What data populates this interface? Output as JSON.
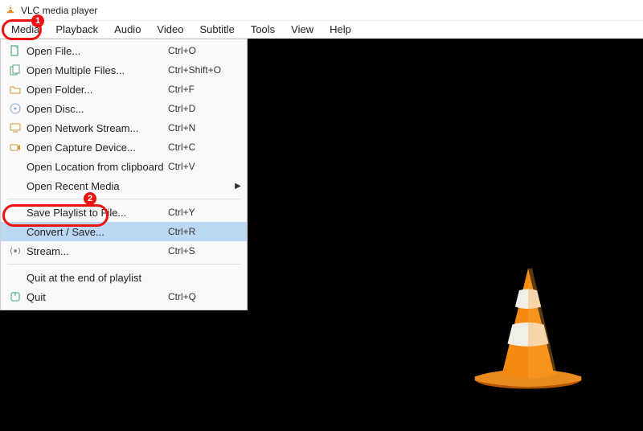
{
  "title": "VLC media player",
  "menubar": [
    "Media",
    "Playback",
    "Audio",
    "Video",
    "Subtitle",
    "Tools",
    "View",
    "Help"
  ],
  "active_menu_index": 0,
  "media_menu": {
    "groups": [
      [
        {
          "icon": "file",
          "label": "Open File...",
          "shortcut": "Ctrl+O"
        },
        {
          "icon": "files",
          "label": "Open Multiple Files...",
          "shortcut": "Ctrl+Shift+O"
        },
        {
          "icon": "folder",
          "label": "Open Folder...",
          "shortcut": "Ctrl+F"
        },
        {
          "icon": "disc",
          "label": "Open Disc...",
          "shortcut": "Ctrl+D"
        },
        {
          "icon": "net",
          "label": "Open Network Stream...",
          "shortcut": "Ctrl+N"
        },
        {
          "icon": "cap",
          "label": "Open Capture Device...",
          "shortcut": "Ctrl+C"
        },
        {
          "icon": "",
          "label": "Open Location from clipboard",
          "shortcut": "Ctrl+V"
        },
        {
          "icon": "",
          "label": "Open Recent Media",
          "shortcut": "",
          "submenu": true
        }
      ],
      [
        {
          "icon": "",
          "label": "Save Playlist to File...",
          "shortcut": "Ctrl+Y"
        },
        {
          "icon": "",
          "label": "Convert / Save...",
          "shortcut": "Ctrl+R",
          "highlight": true
        },
        {
          "icon": "stream",
          "label": "Stream...",
          "shortcut": "Ctrl+S"
        }
      ],
      [
        {
          "icon": "",
          "label": "Quit at the end of playlist",
          "shortcut": ""
        },
        {
          "icon": "quit",
          "label": "Quit",
          "shortcut": "Ctrl+Q"
        }
      ]
    ]
  },
  "annotations": [
    "1",
    "2"
  ]
}
